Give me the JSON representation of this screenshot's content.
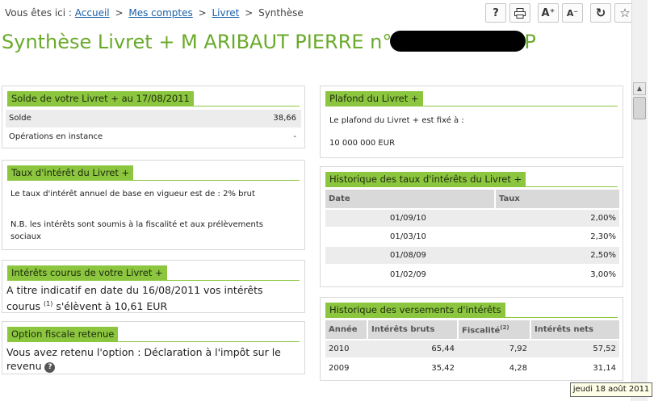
{
  "breadcrumb": {
    "prefix": "Vous êtes ici :",
    "items": [
      "Accueil",
      "Mes comptes",
      "Livret",
      "Synthèse"
    ],
    "sep": ">"
  },
  "toolbar": {
    "icons": [
      "help-icon",
      "print-icon",
      "font-increase-icon",
      "font-decrease-icon",
      "refresh-icon",
      "favorite-star-icon"
    ],
    "labels": [
      "?",
      "⎙",
      "A⁺",
      "A⁻",
      "↻",
      "☆"
    ]
  },
  "title": {
    "prefix": "Synthèse Livret + M ARIBAUT PIERRE n°",
    "suffix": "P"
  },
  "solde": {
    "heading": "Solde de votre Livret + au 17/08/2011",
    "rows": [
      {
        "label": "Solde",
        "value": "38,66"
      },
      {
        "label": "Opérations en instance",
        "value": "-"
      }
    ]
  },
  "taux": {
    "heading": "Taux d'intérêt du Livret +",
    "line1": "Le taux d'intérêt annuel de base en vigueur est de : 2% brut",
    "line2": "N.B. les intérêts sont soumis à la fiscalité et aux prélèvements",
    "line3": "sociaux"
  },
  "interets": {
    "heading": "Intérêts courus de votre Livret +",
    "text1": "A titre indicatif en date du 16/08/2011 vos intérêts",
    "text2a": "courus ",
    "note": "(1)",
    "text2b": " s'élèvent à 10,61 EUR"
  },
  "option": {
    "heading": "Option fiscale retenue",
    "text1": "Vous avez retenu l'option : Déclaration à l'impôt sur le",
    "text2": "revenu",
    "help": "?"
  },
  "plafond": {
    "heading": "Plafond du Livret +",
    "line1": "Le plafond du Livret + est fixé à :",
    "amount": "10 000 000 EUR"
  },
  "historique_taux": {
    "heading": "Historique des taux d'intérêts du Livret +",
    "col_date": "Date",
    "col_taux": "Taux",
    "rows": [
      {
        "date": "01/09/10",
        "taux": "2,00%"
      },
      {
        "date": "01/03/10",
        "taux": "2,30%"
      },
      {
        "date": "01/08/09",
        "taux": "2,50%"
      },
      {
        "date": "01/02/09",
        "taux": "3,00%"
      }
    ]
  },
  "versements": {
    "heading": "Historique des versements d'intérêts",
    "col_annee": "Année",
    "col_bruts": "Intérêts bruts",
    "col_fiscalite": "Fiscalité",
    "col_fiscalite_note": "(2)",
    "col_nets": "Intérêts nets",
    "rows": [
      {
        "annee": "2010",
        "bruts": "65,44",
        "fiscalite": "7,92",
        "nets": "57,52"
      },
      {
        "annee": "2009",
        "bruts": "35,42",
        "fiscalite": "4,28",
        "nets": "31,14"
      }
    ]
  },
  "tooltip": "jeudi 18 août 2011",
  "colors": {
    "accent": "#8cc63f",
    "title": "#6aaa2a",
    "link": "#1a5fa8"
  }
}
